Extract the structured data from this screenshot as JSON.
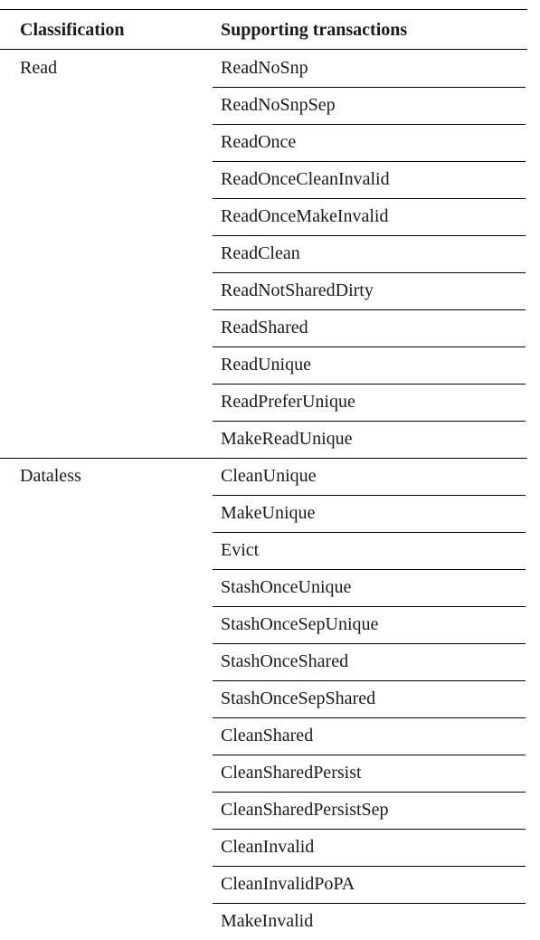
{
  "header": {
    "classification": "Classification",
    "supporting": "Supporting transactions"
  },
  "groups": [
    {
      "label": "Read",
      "transactions": [
        "ReadNoSnp",
        "ReadNoSnpSep",
        "ReadOnce",
        "ReadOnceCleanInvalid",
        "ReadOnceMakeInvalid",
        "ReadClean",
        "ReadNotSharedDirty",
        "ReadShared",
        "ReadUnique",
        "ReadPreferUnique",
        "MakeReadUnique"
      ]
    },
    {
      "label": "Dataless",
      "transactions": [
        "CleanUnique",
        "MakeUnique",
        "Evict",
        "StashOnceUnique",
        "StashOnceSepUnique",
        "StashOnceShared",
        "StashOnceSepShared",
        "CleanShared",
        "CleanSharedPersist",
        "CleanSharedPersistSep",
        "CleanInvalid",
        "CleanInvalidPoPA",
        "MakeInvalid"
      ]
    }
  ]
}
